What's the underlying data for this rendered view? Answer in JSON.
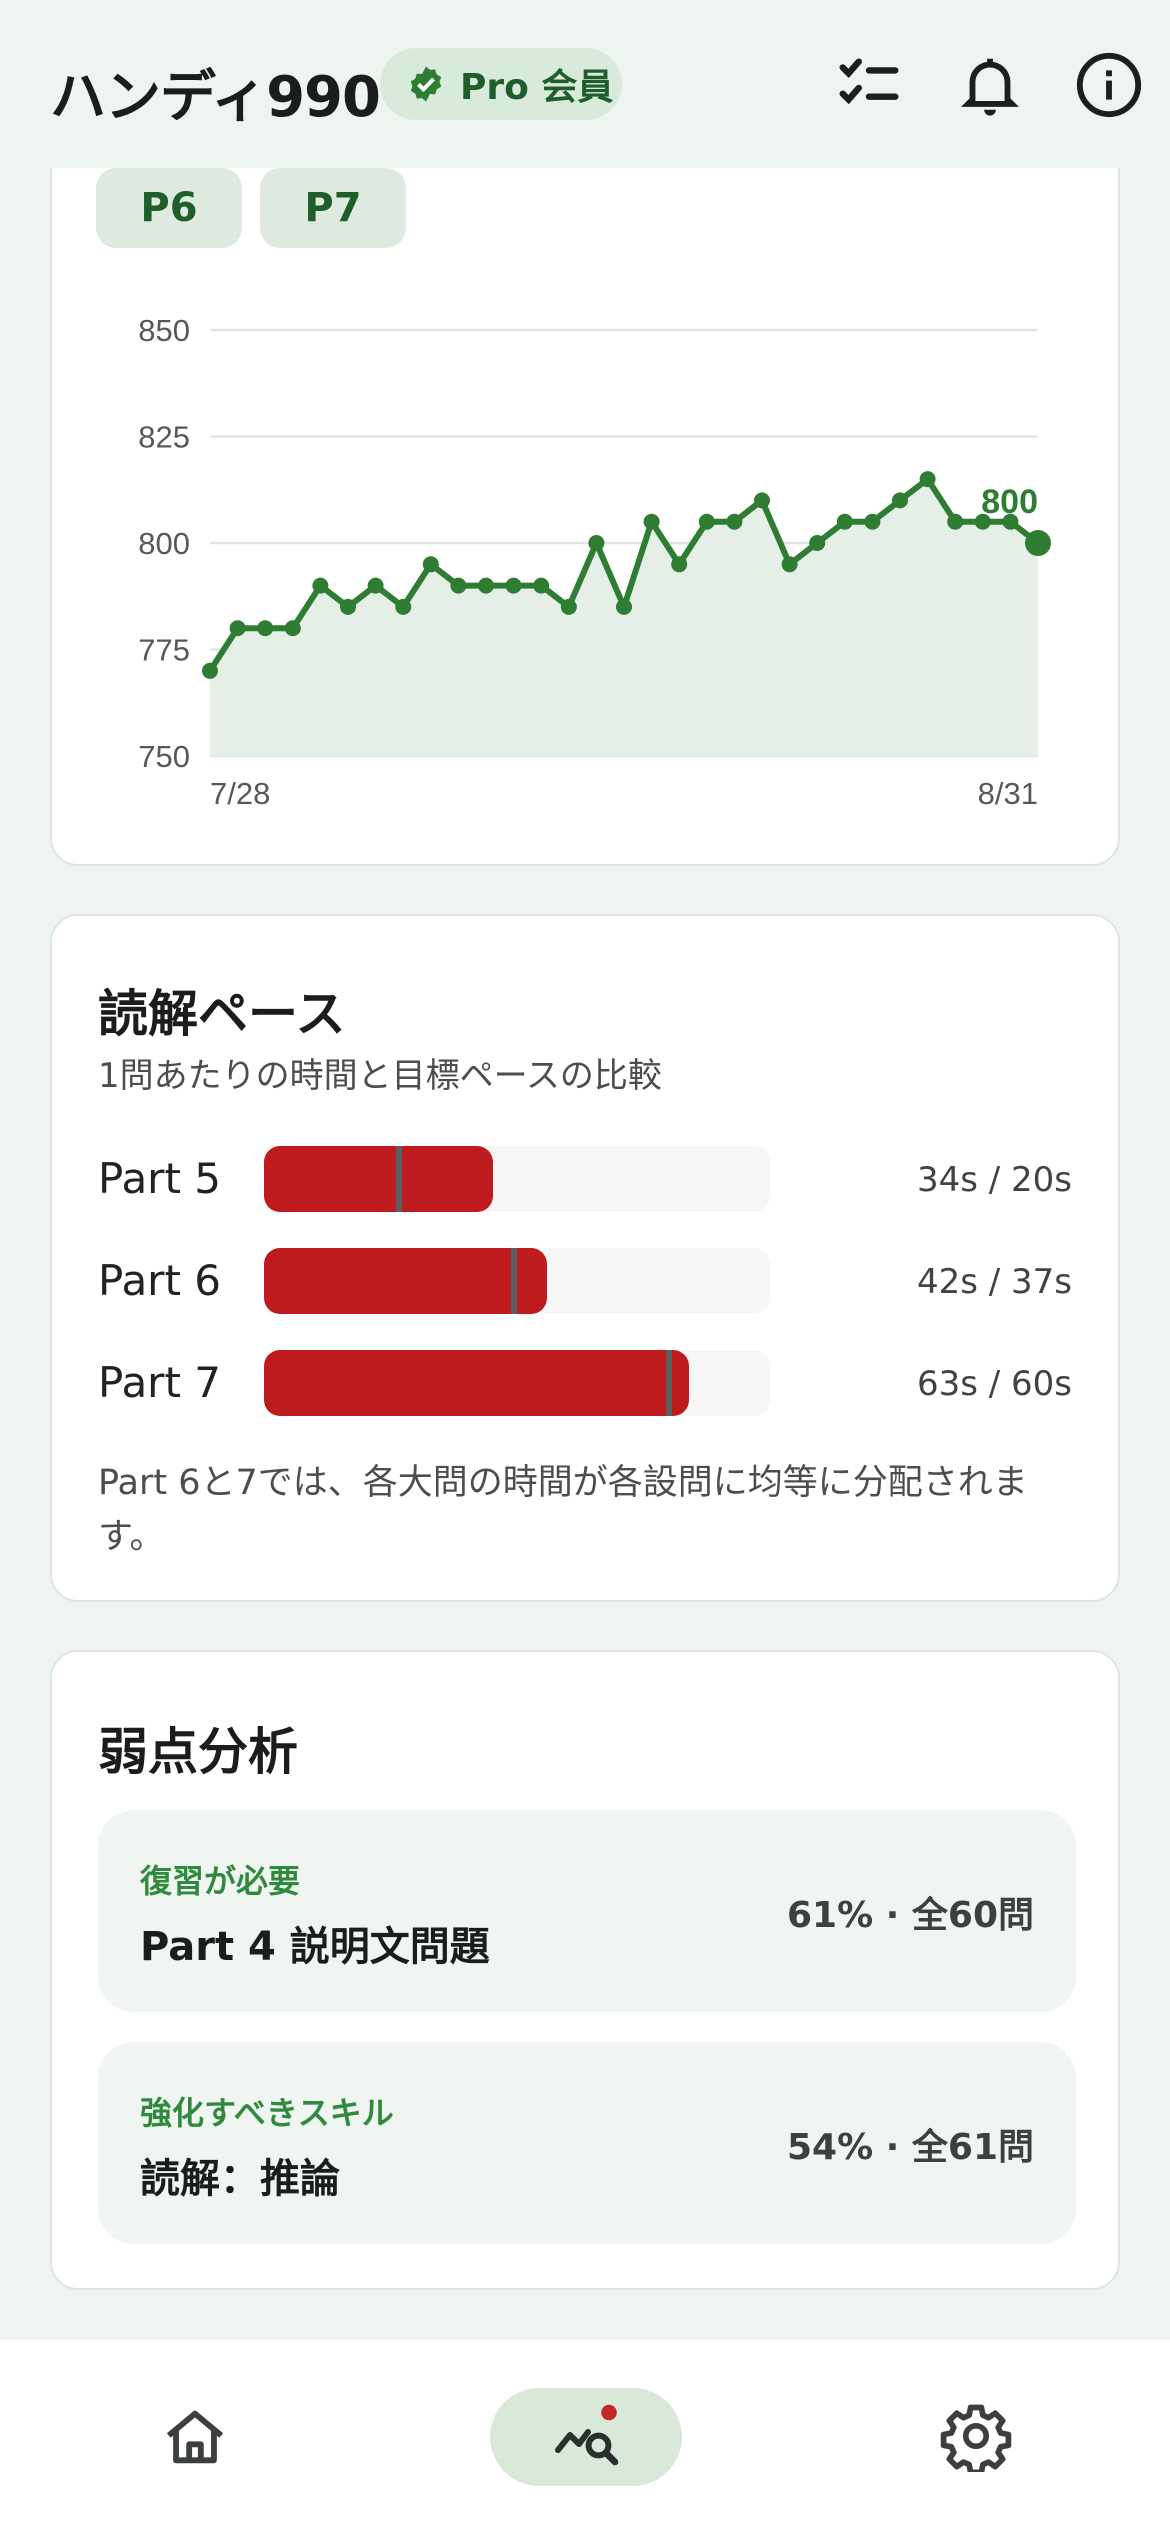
{
  "header": {
    "title": "ハンディ990",
    "badge_label": "Pro 会員"
  },
  "score_card": {
    "chips": [
      "P6",
      "P7"
    ]
  },
  "chart_data": {
    "type": "area",
    "y_ticks": [
      850,
      825,
      800,
      775,
      750
    ],
    "ylim": [
      750,
      850
    ],
    "x_start_label": "7/28",
    "x_end_label": "8/31",
    "x": [
      "7/28",
      "7/29",
      "7/30",
      "7/31",
      "8/1",
      "8/2",
      "8/3",
      "8/4",
      "8/5",
      "8/6",
      "8/7",
      "8/8",
      "8/9",
      "8/10",
      "8/11",
      "8/12",
      "8/13",
      "8/14",
      "8/15",
      "8/16",
      "8/17",
      "8/18",
      "8/19",
      "8/20",
      "8/21",
      "8/22",
      "8/23",
      "8/24",
      "8/25",
      "8/26",
      "8/27",
      "8/28",
      "8/29",
      "8/30",
      "8/31"
    ],
    "values": [
      770,
      780,
      780,
      780,
      790,
      785,
      790,
      785,
      795,
      790,
      790,
      790,
      790,
      785,
      800,
      785,
      805,
      795,
      805,
      805,
      810,
      795,
      800,
      805,
      805,
      810,
      815,
      805,
      805,
      805,
      800
    ],
    "last_value_label": "800",
    "grid": true,
    "colors": {
      "line": "#2e7d32",
      "area": "#e5efe7",
      "grid": "#dfe5ec"
    }
  },
  "pace": {
    "title": "読解ペース",
    "subtitle": "1問あたりの時間と目標ペースの比較",
    "rows": [
      {
        "label": "Part 5",
        "actual": 34,
        "target": 20,
        "text": "34s / 20s"
      },
      {
        "label": "Part 6",
        "actual": 42,
        "target": 37,
        "text": "42s / 37s"
      },
      {
        "label": "Part 7",
        "actual": 63,
        "target": 60,
        "text": "63s / 60s"
      }
    ],
    "scale_max": 75,
    "note": "Part 6と7では、各大問の時間が各設問に均等に分配されます。"
  },
  "weakness": {
    "title": "弱点分析",
    "items": [
      {
        "category": "復習が必要",
        "title": "Part 4 説明文問題",
        "stat": "61% · 全60問"
      },
      {
        "category": "強化すべきスキル",
        "title": "読解：推論",
        "stat": "54% · 全61問"
      }
    ]
  },
  "icons": {
    "header": [
      "verified-check-icon",
      "checklist-icon",
      "bell-icon",
      "info-icon"
    ],
    "nav": [
      "home-icon",
      "analytics-icon",
      "settings-icon"
    ]
  },
  "colors": {
    "accent": "#2e7d32",
    "bar": "#be1b1e",
    "background": "#eef5f0"
  }
}
